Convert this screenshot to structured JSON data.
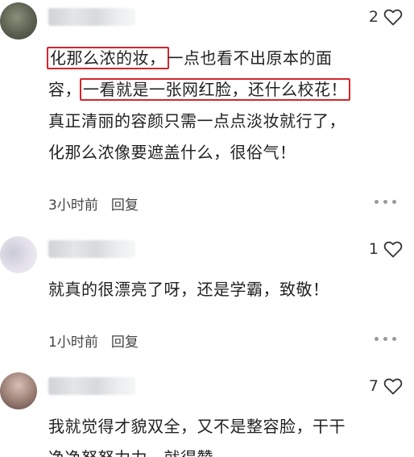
{
  "comments": [
    {
      "likes": "2",
      "highlight_1": "化那么浓的妆，",
      "line_1_rest": "一点也看不出原本的面",
      "line_2_start": "容，",
      "highlight_2": "一看就是一张网红脸，还什么校花！",
      "line_3": "真正清丽的容颜只需一点点淡妆就行了，",
      "line_4": "化那么浓像要遮盖什么，很俗气！",
      "time": "3小时前",
      "reply": "回复"
    },
    {
      "likes": "1",
      "line_1": "就真的很漂亮了呀，还是学霸，致敬！",
      "time": "1小时前",
      "reply": "回复"
    },
    {
      "likes": "7",
      "line_1": "我就觉得才貌双全，又不是整容脸，干干",
      "line_2": "净净努努力力，就得赞"
    }
  ],
  "colors": {
    "highlight_border": "#d4252b",
    "meta_text": "#444444"
  },
  "icons": {
    "like": "heart-outline-icon",
    "more": "more-dots-icon"
  }
}
